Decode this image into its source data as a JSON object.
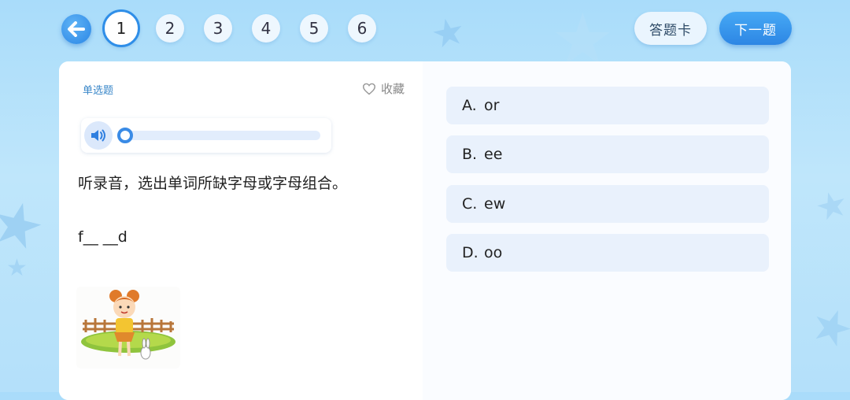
{
  "header": {
    "question_numbers": [
      "1",
      "2",
      "3",
      "4",
      "5",
      "6"
    ],
    "active_question": "1",
    "answer_card_label": "答题卡",
    "next_label": "下一题"
  },
  "question": {
    "type_label": "单选题",
    "favorite_label": "收藏",
    "audio_progress": 0,
    "prompt": "听录音，选出单词所缺字母或字母组合。",
    "word": "f__ __d"
  },
  "options": [
    {
      "letter": "A.",
      "text": "or"
    },
    {
      "letter": "B.",
      "text": "ee"
    },
    {
      "letter": "C.",
      "text": "ew"
    },
    {
      "letter": "D.",
      "text": "oo"
    }
  ],
  "icons": {
    "back": "back-arrow-icon",
    "favorite": "heart-outline-icon",
    "audio": "speaker-icon"
  },
  "colors": {
    "accent": "#2f8ee8",
    "background": "#b4e0fa",
    "option_bg": "#e9f1fc",
    "tag_text": "#3a87c9"
  }
}
